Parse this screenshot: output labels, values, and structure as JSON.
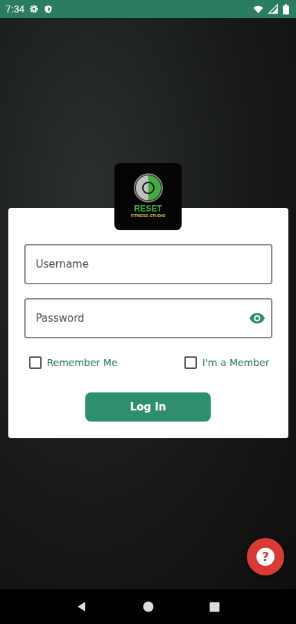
{
  "status_bar": {
    "time": "7:34"
  },
  "logo": {
    "title": "RESET",
    "subtitle": "FITNESS STUDIO"
  },
  "form": {
    "fields": [
      {
        "placeholder": "Username",
        "kind": "text"
      },
      {
        "placeholder": "Password",
        "kind": "password"
      }
    ],
    "checkboxes": [
      {
        "label": "Remember Me",
        "checked": false
      },
      {
        "label": "I'm a Member",
        "checked": false
      }
    ],
    "button": "Log In"
  },
  "help": {
    "label": "?"
  }
}
